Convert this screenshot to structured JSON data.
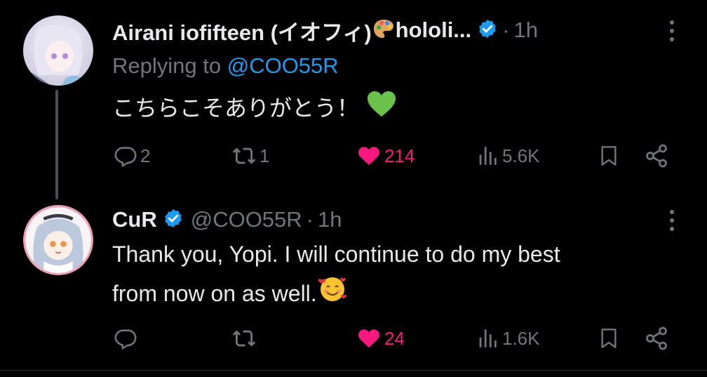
{
  "colors": {
    "background": "#000000",
    "text_primary": "#e7e9ea",
    "text_secondary": "#71767b",
    "accent": "#1d9bf0",
    "like": "#f91880",
    "heart_emoji": "#6ac24b"
  },
  "tweets": [
    {
      "author_name": "Airani iofifteen (イオフィ)",
      "author_name_emoji": "artist-palette-emoji",
      "author_name_suffix": "hololi...",
      "verified": true,
      "separator": "·",
      "time": "1h",
      "replying_label": "Replying to",
      "replying_to": "@COO55R",
      "text": "こちらこそありがとう！",
      "text_emoji": "green-heart-emoji",
      "actions": {
        "reply": "2",
        "retweet": "1",
        "like": "214",
        "views": "5.6K"
      },
      "liked": true
    },
    {
      "author_name": "CuR",
      "verified": true,
      "handle": "@COO55R",
      "separator": "·",
      "time": "1h",
      "text_line1": "Thank you, Yopi. I will continue to do my best",
      "text_line2": "from now on as well.",
      "text_emoji": "smiling-face-with-hearts-emoji",
      "actions": {
        "reply": "",
        "retweet": "",
        "like": "24",
        "views": "1.6K"
      },
      "liked": true
    }
  ]
}
